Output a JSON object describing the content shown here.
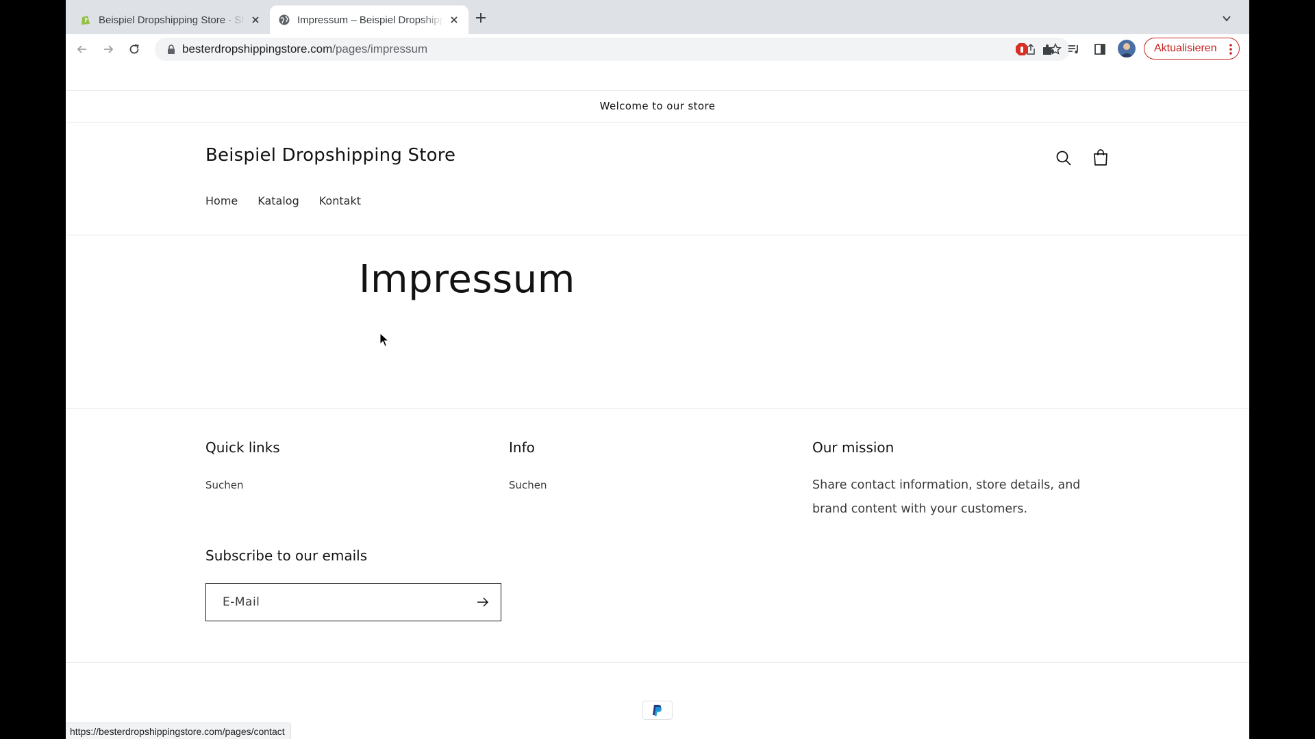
{
  "tabs": [
    {
      "title": "Beispiel Dropshipping Store · Shopify",
      "active": false
    },
    {
      "title": "Impressum – Beispiel Dropshipping Store",
      "active": true
    }
  ],
  "toolbar": {
    "url_host": "besterdropshippingstore.com",
    "url_path": "/pages/impressum",
    "update_label": "Aktualisieren"
  },
  "store": {
    "announcement": "Welcome to our store",
    "title": "Beispiel Dropshipping Store",
    "nav": [
      "Home",
      "Katalog",
      "Kontakt"
    ]
  },
  "page": {
    "title": "Impressum"
  },
  "footer": {
    "quick_links": {
      "heading": "Quick links",
      "links": [
        "Suchen"
      ]
    },
    "info": {
      "heading": "Info",
      "links": [
        "Suchen"
      ]
    },
    "mission": {
      "heading": "Our mission",
      "text": "Share contact information, store details, and brand content with your customers."
    },
    "newsletter": {
      "heading": "Subscribe to our emails",
      "placeholder": "E-Mail"
    },
    "payment_icons": [
      "paypal-icon"
    ]
  },
  "status_bar": {
    "url": "https://besterdropshippingstore.com/pages/contact"
  },
  "colors": {
    "tabstrip": "#dee1e6",
    "update_button": "#c5221f",
    "text": "#121212"
  }
}
